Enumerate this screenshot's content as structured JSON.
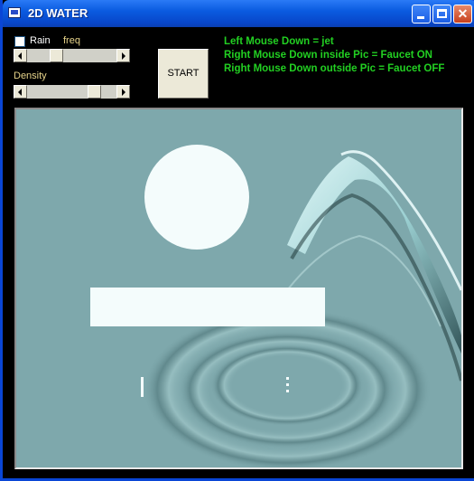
{
  "window": {
    "title": "2D WATER"
  },
  "controls": {
    "rain_label": "Rain",
    "freq_label": "freq",
    "density_label": "Density",
    "start_label": "START",
    "freq_slider_value": 0.3,
    "density_slider_value": 0.8
  },
  "info": {
    "line1": "Left Mouse Down = jet",
    "line2": "Right Mouse Down inside Pic = Faucet ON",
    "line3": "Right Mouse Down outside Pic = Faucet OFF"
  },
  "colors": {
    "title_bar": "#0a5be0",
    "info_text": "#22d022",
    "water": "#7ea8ac",
    "obstacle": "#f4fcfc"
  },
  "icons": [
    "app-icon",
    "minimize-icon",
    "maximize-icon",
    "close-icon"
  ]
}
